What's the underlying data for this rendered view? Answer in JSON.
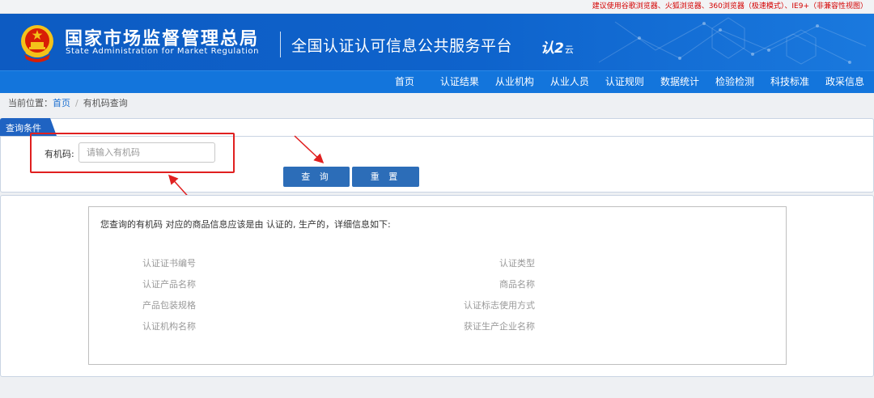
{
  "topbar": {
    "notice": "建议使用谷歌浏览器、火狐浏览器、360浏览器（极速模式）、IE9+（非兼容性视图）"
  },
  "header": {
    "agency_cn": "国家市场监督管理总局",
    "agency_en": "State Administration  for  Market Regulation",
    "platform": "全国认证认可信息公共服务平台",
    "logo_main": "认2",
    "logo_sub": "云"
  },
  "nav": [
    "首页",
    "认证结果",
    "从业机构",
    "从业人员",
    "认证规则",
    "数据统计",
    "检验检测",
    "科技标准",
    "政采信息"
  ],
  "breadcrumb": {
    "prefix": "当前位置：",
    "home": "首页",
    "separator": "/",
    "current": "有机码查询"
  },
  "query": {
    "tab_label": "查询条件",
    "field_label": "有机码:",
    "placeholder": "请输入有机码",
    "value": "",
    "query_button": "查 询",
    "reset_button": "重 置"
  },
  "result": {
    "intro": "您查询的有机码 对应的商品信息应该是由 认证的,  生产的，详细信息如下:",
    "left_fields": [
      "认证证书编号",
      "认证产品名称",
      "产品包装规格",
      "认证机构名称"
    ],
    "right_fields": [
      "认证类型",
      "商品名称",
      "认证标志使用方式",
      "获证生产企业名称"
    ]
  },
  "colors": {
    "banner": "#0e63cc",
    "nav": "#1375dc",
    "button": "#2c6db8",
    "tab": "#1f63c2",
    "annotation": "#e02020",
    "notice": "#d40000"
  },
  "icons": {
    "emblem": "national-emblem-icon"
  }
}
